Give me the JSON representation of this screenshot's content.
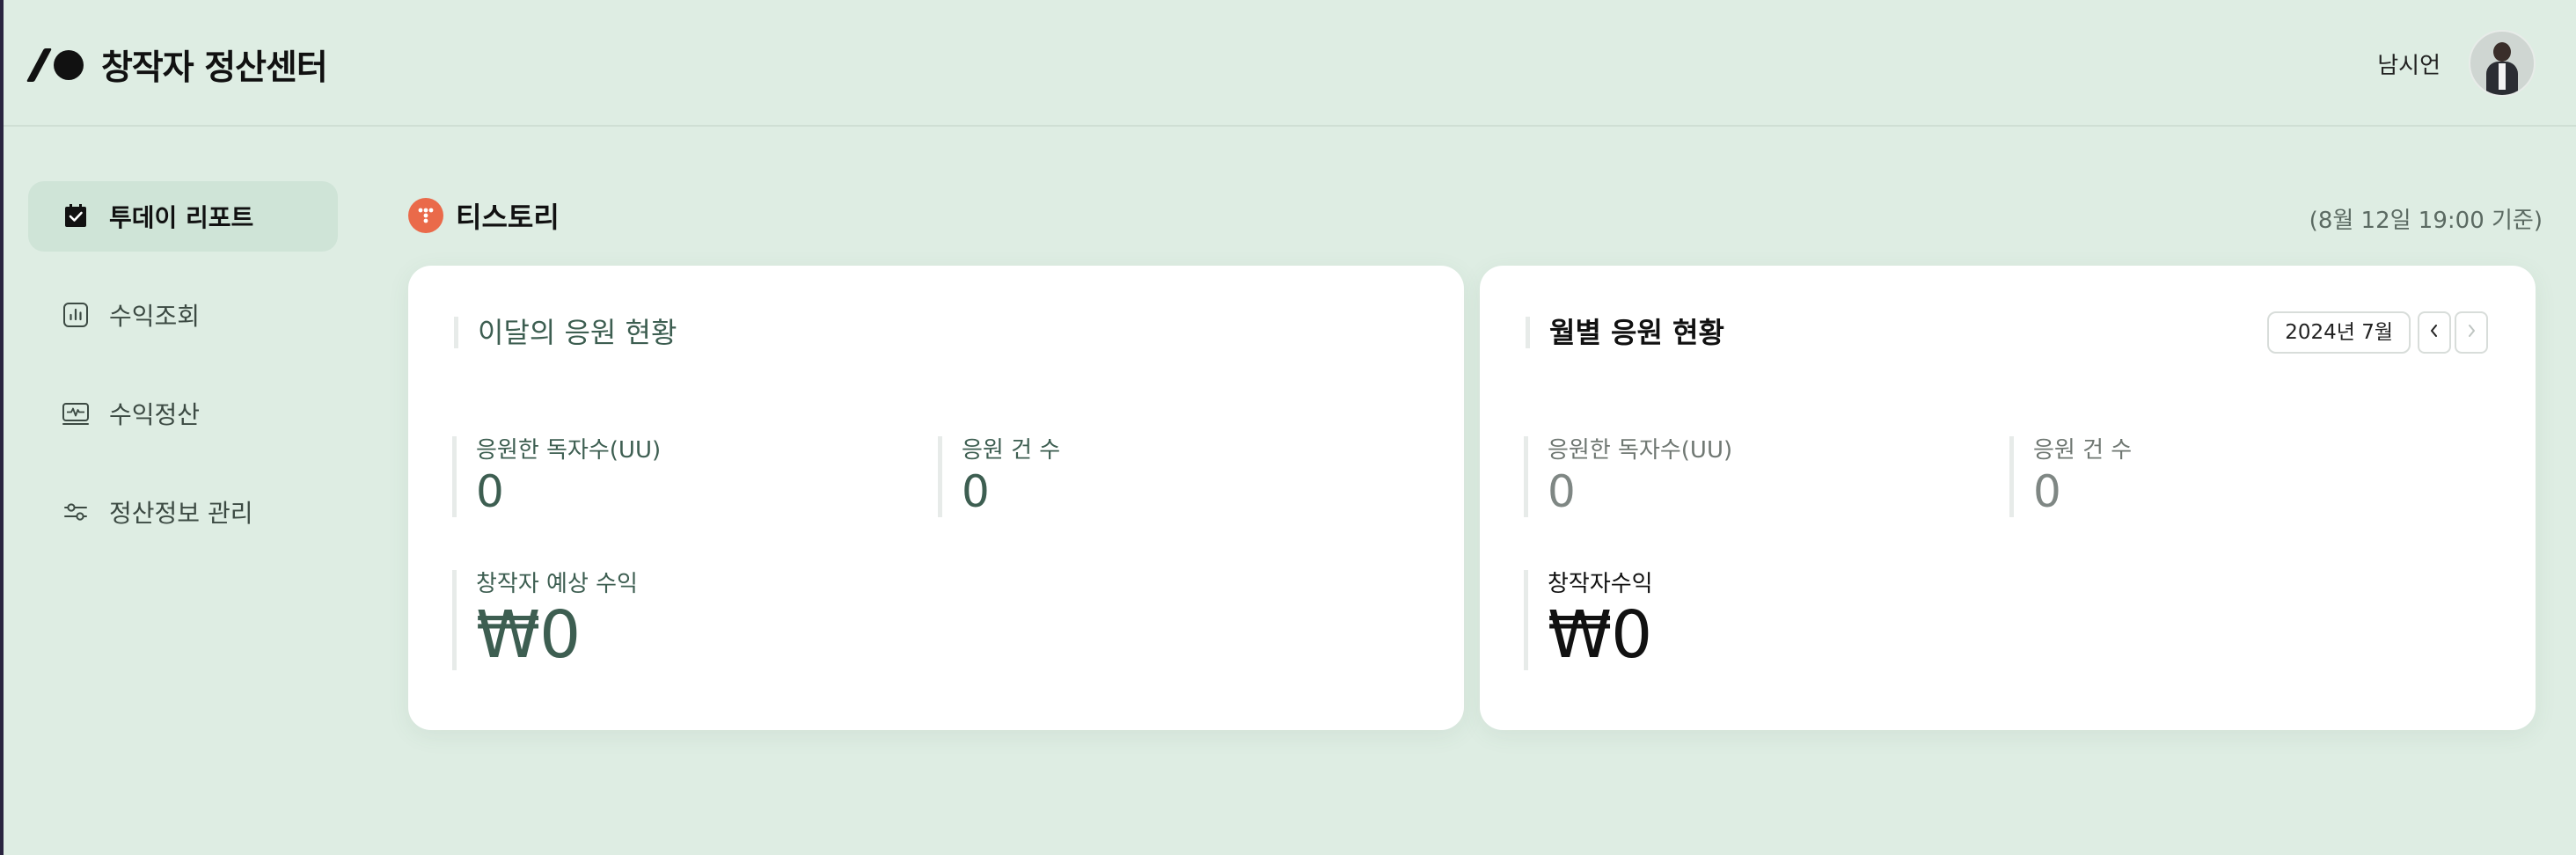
{
  "header": {
    "app_title": "창작자 정산센터",
    "user_name": "남시언"
  },
  "sidebar": {
    "items": [
      {
        "label": "투데이 리포트",
        "icon": "calendar-check-icon",
        "active": true
      },
      {
        "label": "수익조회",
        "icon": "bar-chart-icon",
        "active": false
      },
      {
        "label": "수익정산",
        "icon": "waveform-card-icon",
        "active": false
      },
      {
        "label": "정산정보 관리",
        "icon": "sliders-icon",
        "active": false
      }
    ]
  },
  "content": {
    "blog_name": "티스토리",
    "blog_icon": "tistory-icon",
    "timestamp": "(8월 12일 19:00 기준)"
  },
  "monthly_card": {
    "title": "이달의 응원 현황",
    "readers_label": "응원한 독자수(UU)",
    "readers_value": "0",
    "count_label": "응원 건 수",
    "count_value": "0",
    "earnings_label": "창작자 예상 수익",
    "earnings_value": "₩0"
  },
  "history_card": {
    "title": "월별 응원 현황",
    "month_selector": "2024년 7월",
    "readers_label": "응원한 독자수(UU)",
    "readers_value": "0",
    "count_label": "응원 건 수",
    "count_value": "0",
    "earnings_label": "창작자수익",
    "earnings_value": "₩0"
  },
  "colors": {
    "background": "#deede3",
    "accent_green": "#3d5e51",
    "active_nav": "#cfe4d7",
    "brand_orange": "#ea6a4a"
  }
}
